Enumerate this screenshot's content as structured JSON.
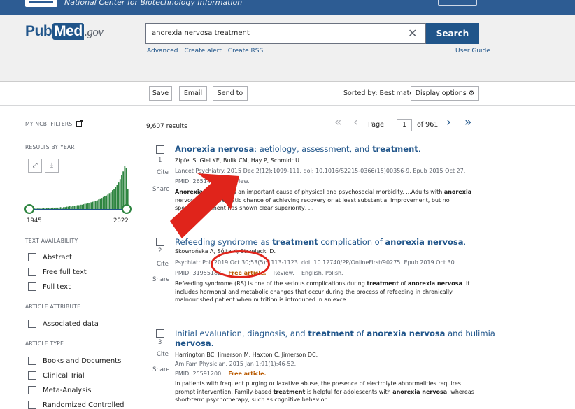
{
  "ncbi": {
    "name": "National Center for Biotechnology Information"
  },
  "logo": {
    "pub": "Pub",
    "med": "Med",
    "gov": ".gov"
  },
  "search": {
    "query": "anorexia nervosa treatment",
    "button": "Search",
    "links": [
      "Advanced",
      "Create alert",
      "Create RSS"
    ],
    "user_guide": "User Guide"
  },
  "toolbar": {
    "save": "Save",
    "email": "Email",
    "send_to": "Send to",
    "sorted_by": "Sorted by: Best match",
    "display_options": "Display options"
  },
  "sidebar": {
    "my_filters": "MY NCBI FILTERS",
    "results_by_year": "RESULTS BY YEAR",
    "year_start": "1945",
    "year_end": "2022",
    "text_availability": "TEXT AVAILABILITY",
    "text_filters": [
      "Abstract",
      "Free full text",
      "Full text"
    ],
    "article_attribute": "ARTICLE ATTRIBUTE",
    "attribute_filters": [
      "Associated data"
    ],
    "article_type": "ARTICLE TYPE",
    "type_filters": [
      "Books and Documents",
      "Clinical Trial",
      "Meta-Analysis",
      "Randomized Controlled"
    ]
  },
  "results": {
    "count": "9,607 results",
    "page_label": "Page",
    "page": "1",
    "of_pages": "of 961",
    "cite": "Cite",
    "share": "Share",
    "items": [
      {
        "num": "1",
        "title_parts": [
          "Anorexia nervosa",
          ": aetiology, assessment, and ",
          "treatment",
          "."
        ],
        "authors": "Zipfel S, Giel KE, Bulik CM, Hay P, Schmidt U.",
        "citation": "Lancet Psychiatry. 2015 Dec;2(12):1099-111. doi: 10.1016/S2215-0366(15)00356-9. Epub 2015 Oct 27.",
        "pmid": "PMID: 26514083",
        "type": "Review.",
        "snippet_1a": "Anorexia nervosa",
        "snippet_1b": " is an important cause of physical and psychosocial morbidity. ...Adults with ",
        "snippet_1c": "anorexia",
        "snippet_2": "nervosa have a realistic chance of achieving recovery or at least substantial improvement, but no",
        "snippet_3": "specific treatment has shown clear superiority, ..."
      },
      {
        "num": "2",
        "title_parts": [
          "Refeeding syndrome as ",
          "treatment",
          " complication of ",
          "anorexia nervosa",
          "."
        ],
        "authors": "Skowrońska A, Sójta K, Strzelecki D.",
        "citation": "Psychiatr Pol. 2019 Oct 30;53(5):1113-1123. doi: 10.12740/PP/OnlineFirst/90275. Epub 2019 Oct 30.",
        "pmid": "PMID: 31955182",
        "free": "Free article.",
        "type": "Review.",
        "lang": "English, Polish.",
        "snippet_1a": "Refeeding syndrome (RS) is one of the serious complications during ",
        "snippet_1b": "treatment",
        "snippet_1c": " of ",
        "snippet_1d": "anorexia nervosa",
        "snippet_1e": ". It",
        "snippet_2": "includes hormonal and metabolic changes that occur during the process of refeeding in chronically",
        "snippet_3": "malnourished patient when nutrition is introduced in an exce ..."
      },
      {
        "num": "3",
        "title_parts": [
          "Initial evaluation, diagnosis, and ",
          "treatment",
          " of ",
          "anorexia nervosa",
          " and bulimia ",
          "nervosa",
          "."
        ],
        "authors": "Harrington BC, Jimerson M, Haxton C, Jimerson DC.",
        "citation": "Am Fam Physician. 2015 Jan 1;91(1):46-52.",
        "pmid": "PMID: 25591200",
        "free": "Free article.",
        "snippet_1": "In patients with frequent purging or laxative abuse, the presence of electrolyte abnormalities requires",
        "snippet_2a": "prompt intervention. Family-based ",
        "snippet_2b": "treatment",
        "snippet_2c": " is helpful for adolescents with ",
        "snippet_2d": "anorexia nervosa",
        "snippet_2e": ", whereas",
        "snippet_3": "short-term psychotherapy, such as cognitive behavior ..."
      }
    ]
  },
  "histogram": [
    1,
    1,
    1,
    1,
    1,
    1,
    1,
    1,
    1,
    2,
    1,
    2,
    2,
    2,
    2,
    3,
    2,
    3,
    3,
    3,
    4,
    3,
    4,
    4,
    5,
    5,
    6,
    5,
    6,
    7,
    7,
    8,
    8,
    9,
    9,
    10,
    11,
    11,
    12,
    13,
    14,
    15,
    16,
    17,
    18,
    20,
    22,
    23,
    25,
    27,
    28,
    30,
    33,
    36,
    39,
    42,
    46,
    50,
    55,
    62,
    70,
    78,
    90,
    85,
    42
  ],
  "colors": {
    "brand": "#20558a",
    "ncbi_bar": "#2d5c93",
    "free": "#b95a00",
    "annotation": "#e0241b",
    "slider": "#2e8540"
  }
}
